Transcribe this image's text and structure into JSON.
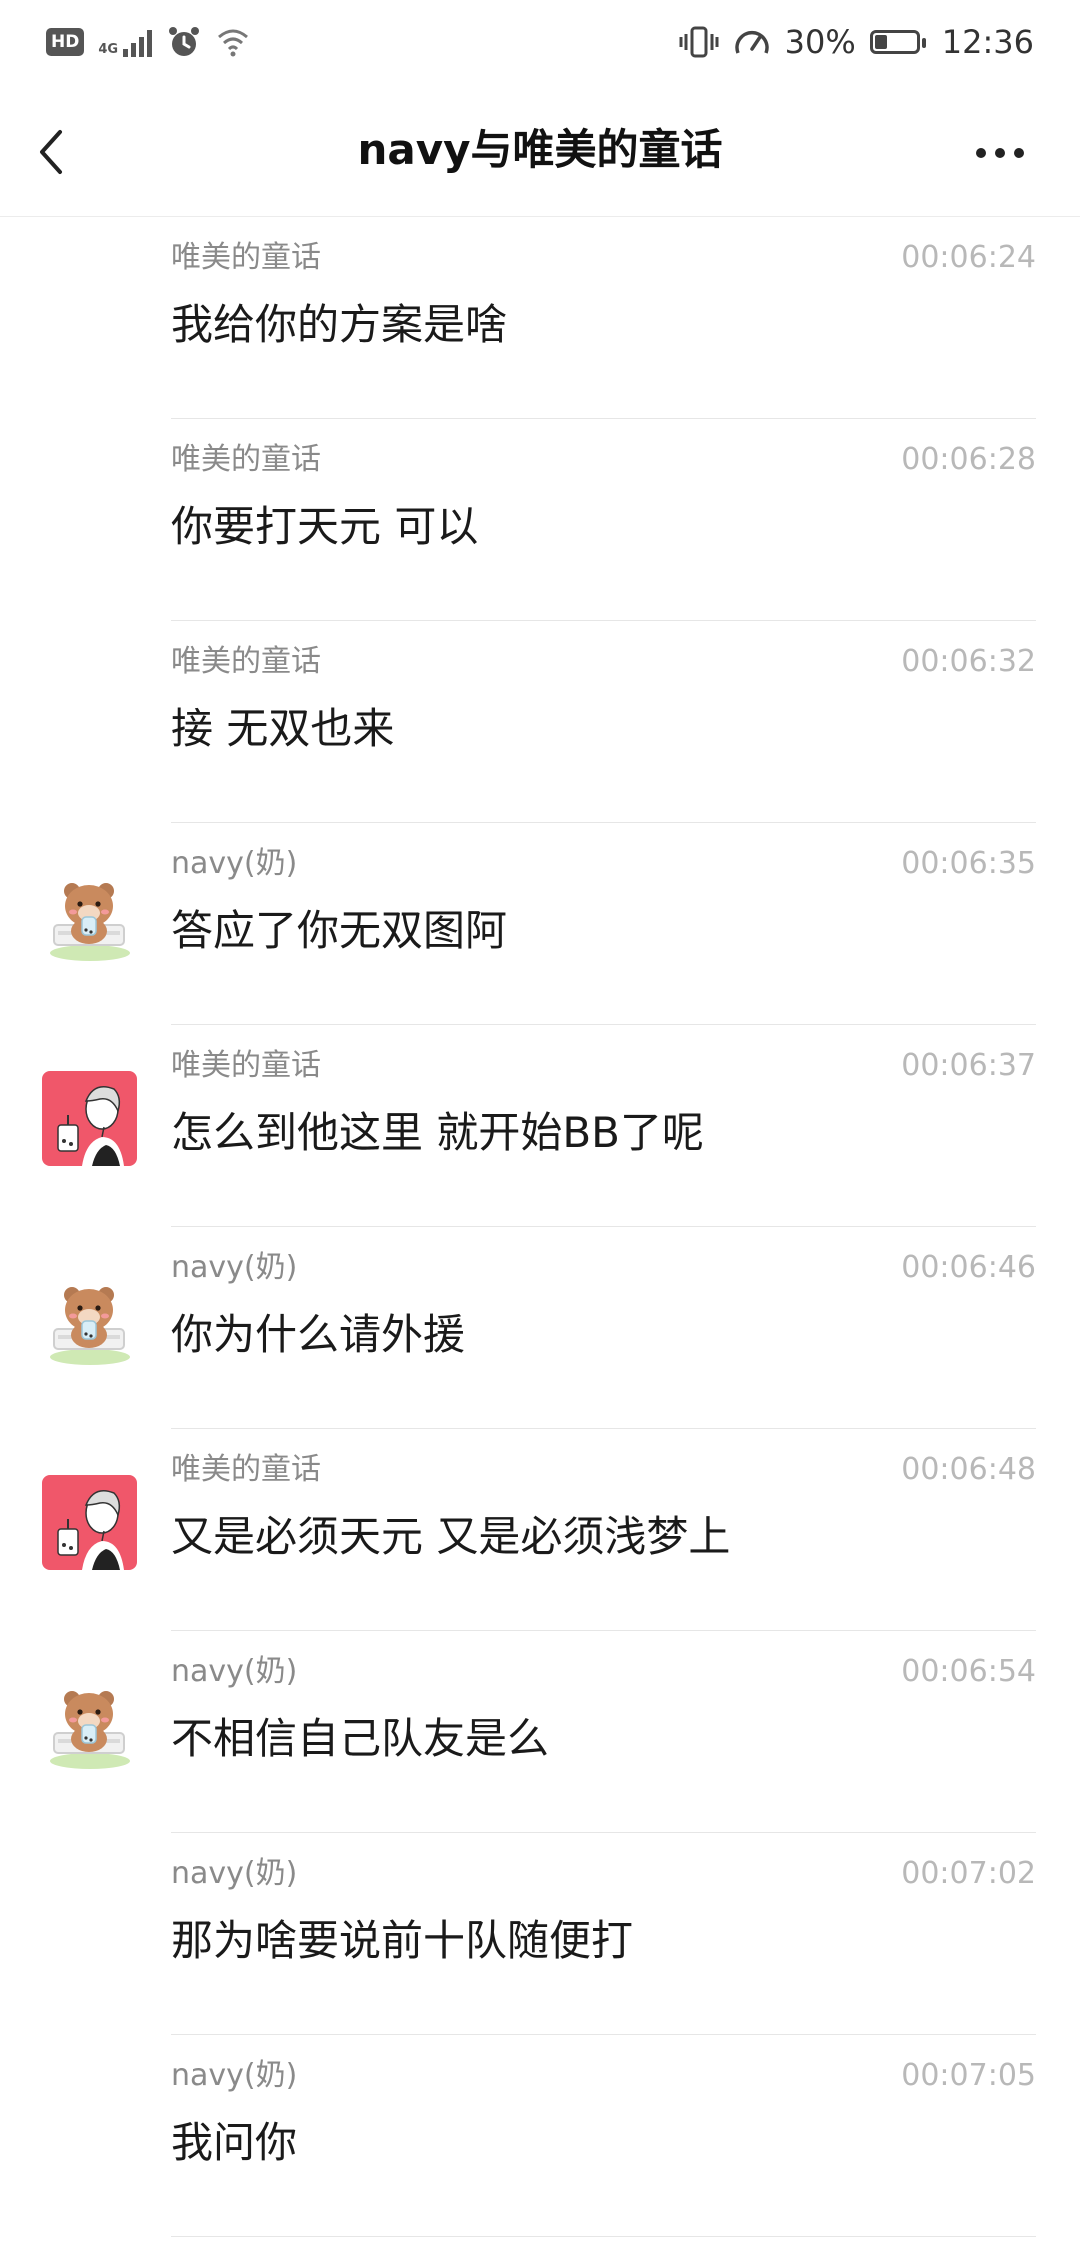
{
  "status_bar": {
    "hd_label": "HD",
    "network_label": "4G",
    "battery_percent": "30%",
    "battery_level": 0.3,
    "time": "12:36",
    "icons": [
      "hd-icon",
      "signal-icon",
      "alarm-icon",
      "wifi-icon",
      "vibrate-icon",
      "speed-icon",
      "battery-icon"
    ]
  },
  "header": {
    "title": "navy与唯美的童话",
    "back_icon": "chevron-left-icon",
    "more_icon": "more-dots-icon"
  },
  "messages": [
    {
      "sender": "唯美的童话",
      "time": "00:06:24",
      "text": "我给你的方案是啥",
      "avatar": ""
    },
    {
      "sender": "唯美的童话",
      "time": "00:06:28",
      "text": "你要打天元 可以",
      "avatar": ""
    },
    {
      "sender": "唯美的童话",
      "time": "00:06:32",
      "text": "接 无双也来",
      "avatar": ""
    },
    {
      "sender": "navy(奶)",
      "time": "00:06:35",
      "text": "答应了你无双图阿",
      "avatar": "bear-avatar"
    },
    {
      "sender": "唯美的童话",
      "time": "00:06:37",
      "text": "怎么到他这里 就开始BB了呢",
      "avatar": "girl-avatar"
    },
    {
      "sender": "navy(奶)",
      "time": "00:06:46",
      "text": "你为什么请外援",
      "avatar": "bear-avatar"
    },
    {
      "sender": "唯美的童话",
      "time": "00:06:48",
      "text": "又是必须天元 又是必须浅梦上",
      "avatar": "girl-avatar"
    },
    {
      "sender": "navy(奶)",
      "time": "00:06:54",
      "text": "不相信自己队友是么",
      "avatar": "bear-avatar"
    },
    {
      "sender": "navy(奶)",
      "time": "00:07:02",
      "text": "那为啥要说前十队随便打",
      "avatar": ""
    },
    {
      "sender": "navy(奶)",
      "time": "00:07:05",
      "text": "我问你",
      "avatar": ""
    }
  ]
}
